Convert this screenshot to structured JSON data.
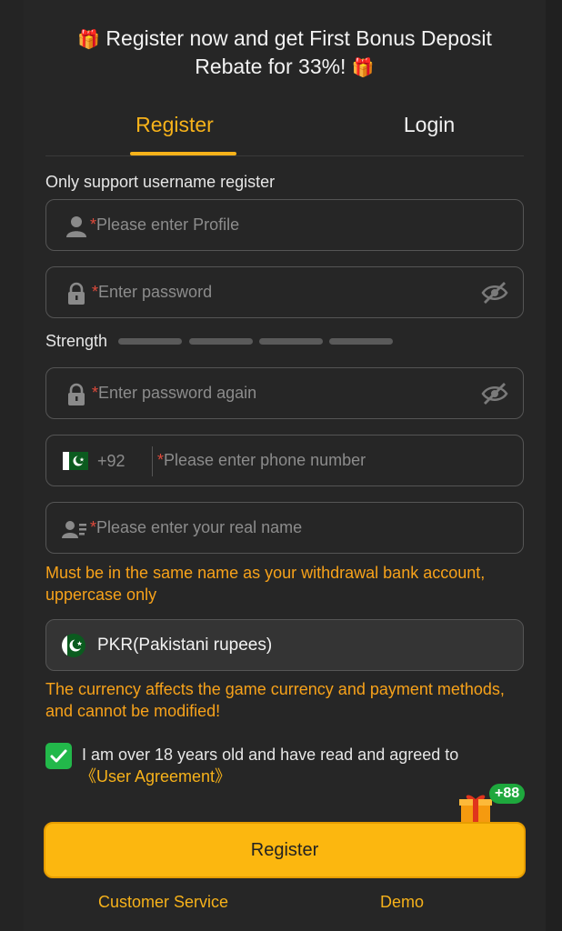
{
  "promo": {
    "line1": "Register now and get First Bonus Deposit",
    "line2": "Rebate for 33%!",
    "gift_glyph": "🎁"
  },
  "tabs": [
    {
      "label": "Register",
      "active": true
    },
    {
      "label": "Login",
      "active": false
    }
  ],
  "form": {
    "hint": "Only support username register",
    "required_mark": "*",
    "profile_placeholder": "Please enter Profile",
    "password_placeholder": "Enter password",
    "strength_label": "Strength",
    "password_again_placeholder": "Enter password again",
    "phone_code": "+92",
    "phone_placeholder": "Please enter phone number",
    "realname_placeholder": "Please enter your real name",
    "realname_warning": "Must be in the same name as your withdrawal bank account, uppercase only",
    "currency_value": "PKR(Pakistani rupees)",
    "currency_warning": "The currency affects the game currency and payment methods, and cannot be modified!",
    "agree_text": "I am over 18 years old and have read and agreed to",
    "agree_link": "《User Agreement》",
    "agree_checked": true,
    "submit_label": "Register"
  },
  "bonus_badge": "+88",
  "footer": {
    "customer_service": "Customer Service",
    "demo": "Demo"
  },
  "colors": {
    "accent": "#f7b21a",
    "button": "#fcb70f",
    "warning": "#f7a21a",
    "check": "#22b84a",
    "required": "#e04a3b"
  }
}
